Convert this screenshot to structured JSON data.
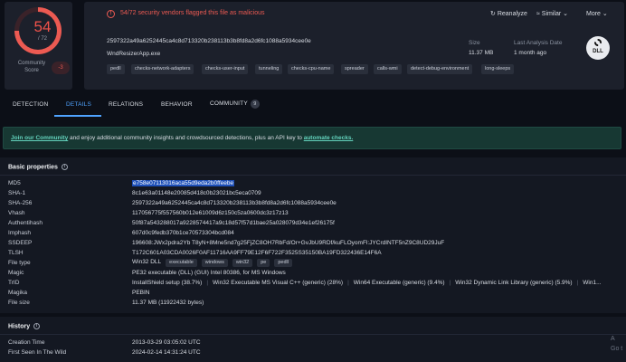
{
  "score": {
    "detected": "54",
    "total": "/ 72",
    "community_label": "Community Score",
    "community_value": "-3"
  },
  "alert": {
    "icon": "!",
    "text": "54/72 security vendors flagged this file as malicious"
  },
  "actions": {
    "reanalyze": "Reanalyze",
    "similar": "Similar",
    "more": "More"
  },
  "file": {
    "sha256": "2597322a49a6252445ca4c8d713320b238113b3b8fd8a2d6fc1088a5934cee0e",
    "name": "WndResizerApp.exe",
    "size_label": "Size",
    "size_value": "11.37 MB",
    "last_analysis_label": "Last Analysis Date",
    "last_analysis_value": "1 month ago",
    "type_icon_text": "DLL"
  },
  "tags": [
    "pedll",
    "checks-network-adapters",
    "checks-user-input",
    "tunneling",
    "checks-cpu-name",
    "spreader",
    "calls-wmi",
    "detect-debug-environment",
    "long-sleeps"
  ],
  "tabs": {
    "detection": "DETECTION",
    "details": "DETAILS",
    "relations": "RELATIONS",
    "behavior": "BEHAVIOR",
    "community": "COMMUNITY",
    "community_count": "9"
  },
  "banner": {
    "link1": "Join our Community",
    "middle": " and enjoy additional community insights and crowdsourced detections, plus an API key to ",
    "link2": "automate checks."
  },
  "basic": {
    "title": "Basic properties",
    "md5_label": "MD5",
    "md5": "e758e07113016aca55d9eda2b0ffeebe",
    "sha1_label": "SHA-1",
    "sha1": "8c1e63a01148e20085d418c0b23021bc5eca0709",
    "sha256_label": "SHA-256",
    "sha256": "2597322a49a6252445ca4c8d713320b238113b3b8fd8a2d6fc1088a5934cee0e",
    "vhash_label": "Vhash",
    "vhash": "117056775f557560b012e61009d6z150c5za0600dc3z17z13",
    "authentihash_label": "Authentihash",
    "authentihash": "50f87a543288017a9228574417a9c18d57f57d1bae25a028079d34e1ef26175f",
    "imphash_label": "Imphash",
    "imphash": "607d0c9fedb370b1ce70573304bcd084",
    "ssdeep_label": "SSDEEP",
    "ssdeep": "196608:JWx2pdra2Yb T8yN+8Mne5nd7g25FjZC8OH7RbFd/Or+GvJbU9RDf/kuFLOyomFl:JYCrdINTF5nZ9C8UD29JuF",
    "tlsh_label": "TLSH",
    "tlsh": "T172C601A03CDA0026F0AF11716AA9FF79E12F6F722F3525S35150BA19FD322436E14F6A",
    "filetype_label": "File type",
    "filetype": "Win32 DLL",
    "filetype_tags": [
      "executable",
      "windows",
      "win32",
      "pe",
      "pedll"
    ],
    "magic_label": "Magic",
    "magic": "PE32 executable (DLL) (GUI) Intel 80386, for MS Windows",
    "trid_label": "TrID",
    "trid": [
      "InstallShield setup (38.7%)",
      "Win32 Executable MS Visual C++ (generic) (28%)",
      "Win64 Executable (generic) (9.4%)",
      "Win32 Dynamic Link Library (generic) (5.9%)",
      "Win1..."
    ],
    "magika_label": "Magika",
    "magika": "PEBIN",
    "filesize_label": "File size",
    "filesize": "11.37 MB (11922432 bytes)"
  },
  "history": {
    "title": "History",
    "creation_label": "Creation Time",
    "creation": "2013-03-29 03:05:02 UTC",
    "first_seen_label": "First Seen In The Wild",
    "first_seen": "2024-02-14 14:31:24 UTC"
  },
  "watermark": {
    "line1": "A",
    "line2": "Go t"
  }
}
